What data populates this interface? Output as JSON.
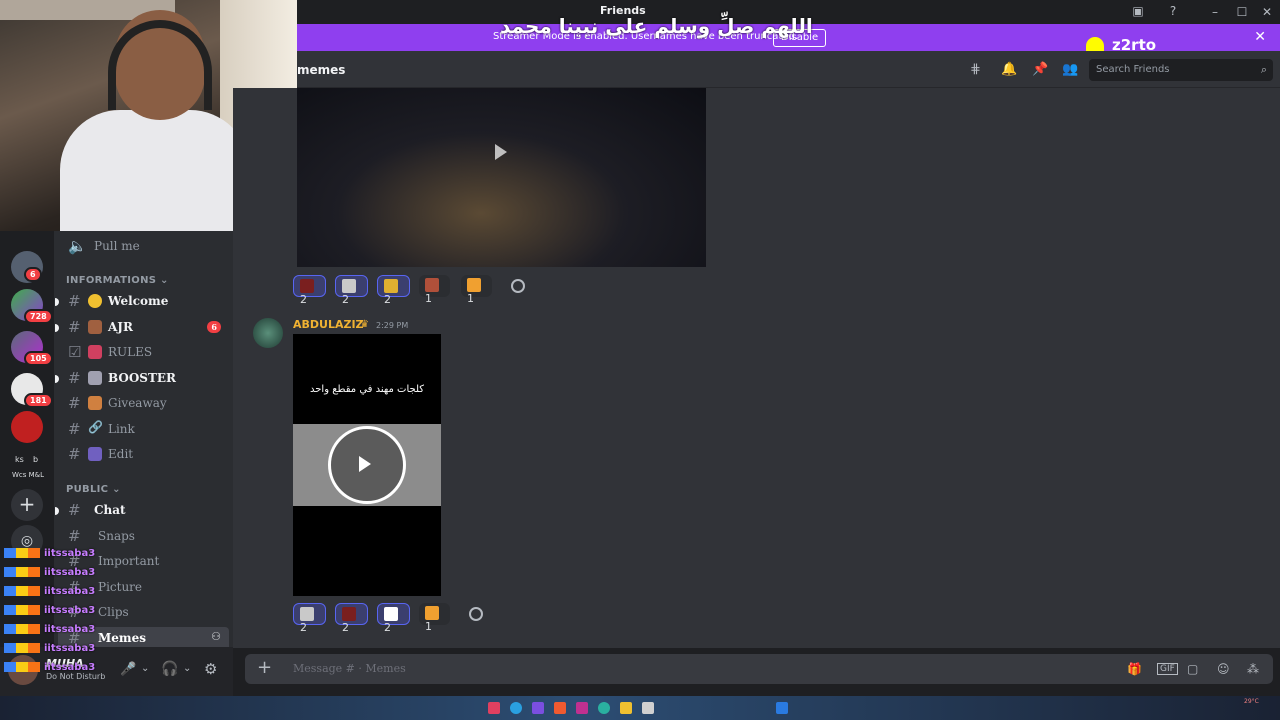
{
  "window": {
    "title": "Friends",
    "overlay_text": "اللهم صلِّ وسلم على نبينا محمد"
  },
  "banner": {
    "message": "Streamer Mode is enabled. Usernames have been truncated.",
    "disable_label": "Disable"
  },
  "overlay": {
    "snapchat_handle": "z2rto"
  },
  "channel_header": {
    "name": "memes",
    "search_placeholder": "Search Friends"
  },
  "channels": {
    "voice_item": "Pull me",
    "categories": [
      {
        "name": "INFORMATIONS",
        "items": [
          {
            "label": "Welcome",
            "unread": true
          },
          {
            "label": "AJR",
            "unread": true,
            "badge": "6"
          },
          {
            "label": "RULES",
            "unread": false
          },
          {
            "label": "BOOSTER",
            "unread": true
          },
          {
            "label": "Giveaway",
            "unread": false
          },
          {
            "label": "Link",
            "unread": false
          },
          {
            "label": "Edit",
            "unread": false
          }
        ]
      },
      {
        "name": "PUBLIC",
        "items": [
          {
            "label": "Chat",
            "unread": true
          },
          {
            "label": "Snaps",
            "unread": false
          },
          {
            "label": "Important",
            "unread": false
          },
          {
            "label": "Picture",
            "unread": false
          },
          {
            "label": "Clips",
            "unread": false
          },
          {
            "label": "Memes",
            "active": true
          }
        ]
      }
    ]
  },
  "guild_badges": [
    "6",
    "728",
    "105",
    "181"
  ],
  "guild_text": {
    "a": "ks",
    "b": "b",
    "c": "Wcs M&L"
  },
  "user": {
    "name": "MUHA",
    "status": "Do Not Disturb"
  },
  "stream_chat": {
    "username": "iitssaba3",
    "rows": 7
  },
  "messages": [
    {
      "reactions": [
        {
          "count": "2",
          "mine": true,
          "color": "#7a1f1f"
        },
        {
          "count": "2",
          "mine": true,
          "color": "#c9c9c9"
        },
        {
          "count": "2",
          "mine": true,
          "color": "#e0b030"
        },
        {
          "count": "1",
          "mine": false,
          "color": "#b0503a"
        },
        {
          "count": "1",
          "mine": false,
          "color": "#f0a030"
        }
      ]
    },
    {
      "author": "ABDULAZIZ",
      "time": "2:29 PM",
      "video_caption": "كلجات مهند في مقطع واحد",
      "reactions": [
        {
          "count": "2",
          "mine": true,
          "color": "#c9c9c9"
        },
        {
          "count": "2",
          "mine": true,
          "color": "#7a1f1f"
        },
        {
          "count": "2",
          "mine": true,
          "color": "#ffffff"
        },
        {
          "count": "1",
          "mine": false,
          "color": "#f0a030"
        }
      ]
    }
  ],
  "composer": {
    "placeholder": "Message # · Memes"
  },
  "taskbar": {
    "weather": "29°C"
  }
}
